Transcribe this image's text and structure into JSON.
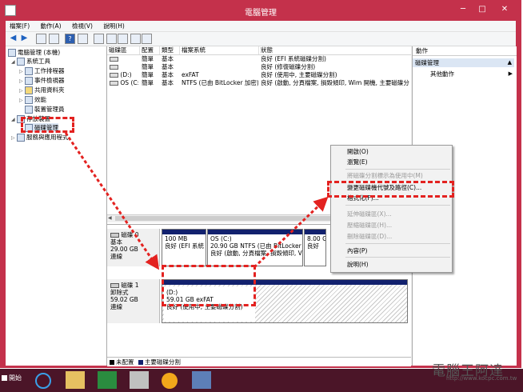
{
  "window": {
    "title": "電腦管理",
    "controls": {
      "minimize": "─",
      "maximize": "□",
      "close": "✕"
    }
  },
  "menubar": [
    "檔案(F)",
    "動作(A)",
    "檢視(V)",
    "說明(H)"
  ],
  "tree": {
    "root": "電腦管理 (本機)",
    "system_tools": "系統工具",
    "task_scheduler": "工作排程器",
    "event_viewer": "事件檢視器",
    "shared_folders": "共用資料夾",
    "performance": "效能",
    "device_manager": "裝置管理員",
    "storage": "存放裝置",
    "disk_management": "磁碟管理",
    "services": "服務與應用程式"
  },
  "volume_table": {
    "headers": [
      "磁碟區",
      "配置",
      "類型",
      "檔案系統",
      "狀態"
    ],
    "rows": [
      [
        "",
        "簡單",
        "基本",
        "",
        "良好 (EFI 系統磁碟分割)"
      ],
      [
        "",
        "簡單",
        "基本",
        "",
        "良好 (修復磁碟分割)"
      ],
      [
        "(D:)",
        "簡單",
        "基本",
        "exFAT",
        "良好 (使用中, 主要磁碟分割)"
      ],
      [
        "OS (C:)",
        "簡單",
        "基本",
        "NTFS (已由 BitLocker 加密)",
        "良好 (啟動, 分頁檔案, 損毀傾印, Wim 開機, 主要磁碟分割)"
      ]
    ]
  },
  "disks": {
    "disk0": {
      "name": "磁碟 0",
      "type": "基本",
      "size": "29.00 GB",
      "status": "連線",
      "partitions": [
        {
          "line1": "",
          "line2": "100 MB",
          "line3": "良好 (EFI 系統"
        },
        {
          "line1": "OS (C:)",
          "line2": "20.90 GB NTFS (已由 BitLocker",
          "line3": "良好 (啟動, 分頁檔案, 損毀傾印, V"
        },
        {
          "line1": "",
          "line2": "8.00 GB",
          "line3": "良好"
        }
      ]
    },
    "disk1": {
      "name": "磁碟 1",
      "type": "卸除式",
      "size": "59.02 GB",
      "status": "連線",
      "partition": {
        "line1": "(D:)",
        "line2": "59.01 GB exFAT",
        "line3": "良好 (使用中, 主要磁碟分割)"
      }
    }
  },
  "legend": {
    "unallocated": "未配置",
    "primary": "主要磁碟分割",
    "colors": {
      "unallocated": "#000000",
      "primary": "#12216e"
    }
  },
  "actions": {
    "header": "動作",
    "section": "磁碟管理",
    "more": "其他動作"
  },
  "context_menu": {
    "open": "開啟(O)",
    "explore": "瀏覽(E)",
    "mark_active": "將磁碟分割標示為使用中(M)",
    "change_letter": "變更磁碟機代號及路徑(C)...",
    "format": "格式化(F)...",
    "extend": "延伸磁碟區(X)...",
    "shrink": "壓縮磁碟區(H)...",
    "delete": "刪除磁碟區(D)...",
    "properties": "內容(P)",
    "help": "說明(H)"
  },
  "taskbar": {
    "start": "開始"
  },
  "watermark": {
    "text": "電腦王阿達",
    "url": "http://www.kocpc.com.tw"
  },
  "colors": {
    "accent": "#c4314b",
    "highlight": "#e32220",
    "partition_bar": "#12216e"
  }
}
